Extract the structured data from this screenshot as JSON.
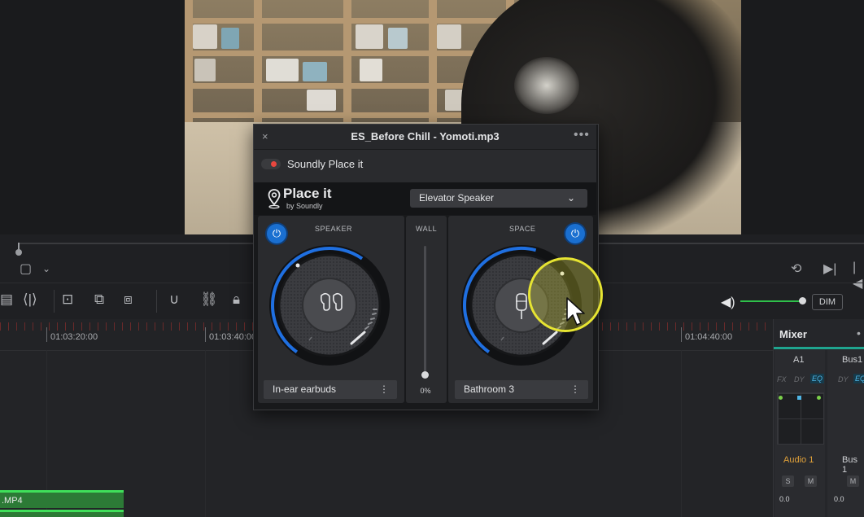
{
  "viewer": {
    "video_description": "video"
  },
  "toolbar": {
    "dim_label": "DIM"
  },
  "timeline": {
    "timecodes": [
      "01:03:20:00",
      "01:03:40:00",
      "01:04:40:00"
    ],
    "clip_label": ".MP4"
  },
  "mixer": {
    "title": "Mixer",
    "more": "•",
    "channels": [
      {
        "id": "A1",
        "fx": "FX",
        "dy": "DY",
        "eq": "EQ",
        "name": "Audio 1",
        "solo": "S",
        "mute": "M",
        "value": "0.0",
        "name_color": "#e0a13a"
      },
      {
        "id": "Bus1",
        "fx": "",
        "dy": "DY",
        "eq": "EQ",
        "name": "Bus 1",
        "solo": "",
        "mute": "M",
        "value": "0.0",
        "name_color": "#cfd1d4"
      }
    ]
  },
  "plugin": {
    "close": "×",
    "title": "ES_Before Chill - Yomoti.mp3",
    "more": "•••",
    "plugin_name": "Soundly Place it",
    "logo": "Place it",
    "logo_sub": "by Soundly",
    "preset": "Elevator Speaker",
    "speaker": {
      "label": "SPEAKER",
      "device": "In-ear earbuds",
      "level": 0.62
    },
    "wall": {
      "label": "WALL",
      "value": "0%"
    },
    "space": {
      "label": "SPACE",
      "room": "Bathroom 3",
      "level": 0.55
    },
    "menu_dots": "⋮"
  },
  "colors": {
    "accent_blue": "#1a6fd0",
    "record_red": "#e8473f",
    "timeline_green": "#3fe05a",
    "mixer_teal": "#1fa58f",
    "cursor_yellow": "#e6e432"
  }
}
